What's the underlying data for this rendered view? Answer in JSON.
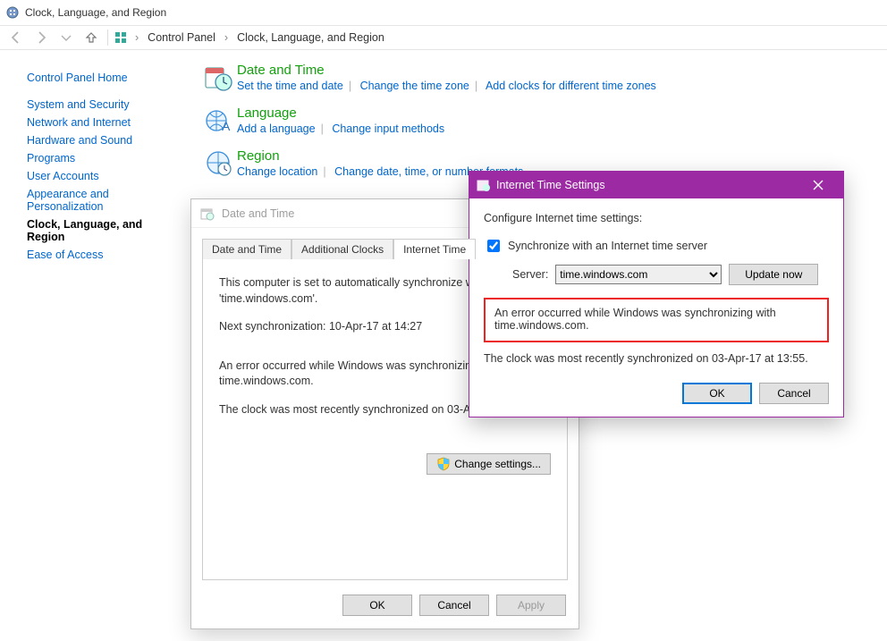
{
  "window": {
    "title": "Clock, Language, and Region"
  },
  "breadcrumb": {
    "a": "Control Panel",
    "b": "Clock, Language, and Region"
  },
  "sidebar": {
    "items": [
      "Control Panel Home",
      "System and Security",
      "Network and Internet",
      "Hardware and Sound",
      "Programs",
      "User Accounts",
      "Appearance and Personalization",
      "Clock, Language, and Region",
      "Ease of Access"
    ]
  },
  "categories": {
    "datetime": {
      "title": "Date and Time",
      "links": [
        "Set the time and date",
        "Change the time zone",
        "Add clocks for different time zones"
      ]
    },
    "language": {
      "title": "Language",
      "links": [
        "Add a language",
        "Change input methods"
      ]
    },
    "region": {
      "title": "Region",
      "links": [
        "Change location",
        "Change date, time, or number formats"
      ]
    }
  },
  "dialog1": {
    "title": "Date and Time",
    "tabs": [
      "Date and Time",
      "Additional Clocks",
      "Internet Time"
    ],
    "body": {
      "p1": "This computer is set to automatically synchronize with 'time.windows.com'.",
      "p2": "Next synchronization: 10-Apr-17 at 14:27",
      "p3": "An error occurred while Windows was synchronizing with time.windows.com.",
      "p4": "The clock was most recently synchronized on 03-Apr-17 at 13:55.",
      "change": "Change settings..."
    },
    "ok": "OK",
    "cancel": "Cancel",
    "apply": "Apply"
  },
  "dialog2": {
    "title": "Internet Time Settings",
    "p1": "Configure Internet time settings:",
    "check": "Synchronize with an Internet time server",
    "serverLabel": "Server:",
    "server": "time.windows.com",
    "update": "Update now",
    "err": "An error occurred while Windows was synchronizing with time.windows.com.",
    "last": "The clock was most recently synchronized on 03-Apr-17 at 13:55.",
    "ok": "OK",
    "cancel": "Cancel"
  }
}
